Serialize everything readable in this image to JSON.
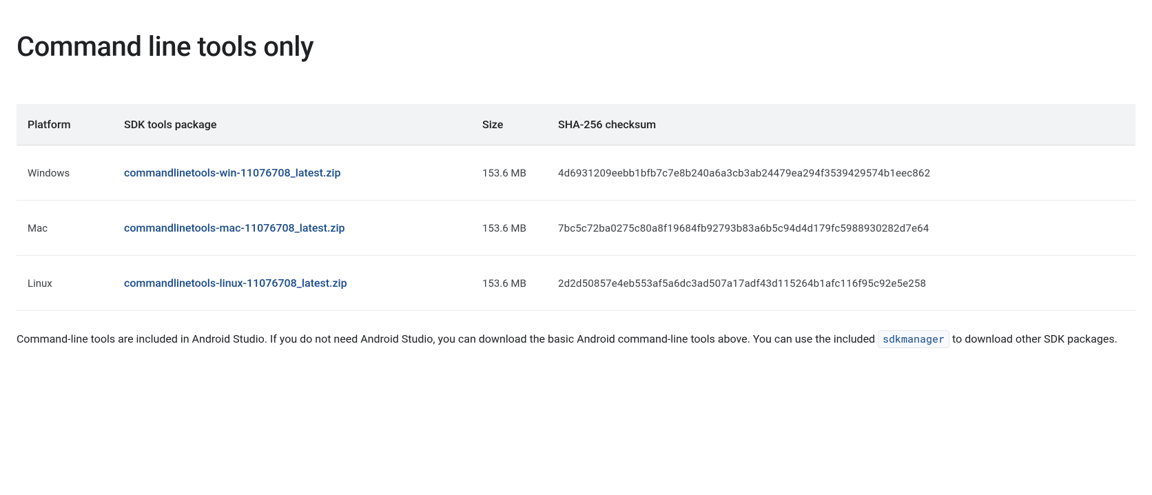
{
  "title": "Command line tools only",
  "table": {
    "headers": {
      "platform": "Platform",
      "package": "SDK tools package",
      "size": "Size",
      "checksum": "SHA-256 checksum"
    },
    "rows": [
      {
        "platform": "Windows",
        "package": "commandlinetools-win-11076708_latest.zip",
        "size": "153.6 MB",
        "checksum": "4d6931209eebb1bfb7c7e8b240a6a3cb3ab24479ea294f3539429574b1eec862"
      },
      {
        "platform": "Mac",
        "package": "commandlinetools-mac-11076708_latest.zip",
        "size": "153.6 MB",
        "checksum": "7bc5c72ba0275c80a8f19684fb92793b83a6b5c94d4d179fc5988930282d7e64"
      },
      {
        "platform": "Linux",
        "package": "commandlinetools-linux-11076708_latest.zip",
        "size": "153.6 MB",
        "checksum": "2d2d50857e4eb553af5a6dc3ad507a17adf43d115264b1afc116f95c92e5e258"
      }
    ]
  },
  "description": {
    "part1": "Command-line tools are included in Android Studio. If you do not need Android Studio, you can download the basic Android command-line tools above. You can use the included ",
    "code": "sdkmanager",
    "part2": " to download other SDK packages."
  }
}
